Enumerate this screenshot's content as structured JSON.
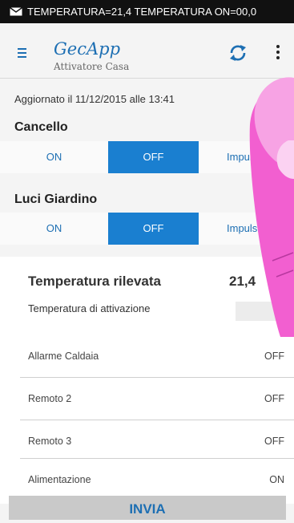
{
  "status_bar": {
    "notification_text": "TEMPERATURA=21,4 TEMPERATURA ON=00,0"
  },
  "app_bar": {
    "title": "GecApp",
    "subtitle": "Attivatore Casa"
  },
  "updated_text": "Aggiornato il 11/12/2015 alle 13:41",
  "switches": [
    {
      "name": "Cancello",
      "options": [
        "ON",
        "OFF",
        "Impuls"
      ],
      "selected": "OFF"
    },
    {
      "name": "Luci Giardino",
      "options": [
        "ON",
        "OFF",
        "Impuls"
      ],
      "selected": "OFF"
    }
  ],
  "temperature": {
    "title": "Temperatura rilevata",
    "value": "21,4",
    "activation_label": "Temperatura di attivazione",
    "activation_value": ""
  },
  "status_rows": [
    {
      "label": "Allarme Caldaia",
      "value": "OFF"
    },
    {
      "label": "Remoto 2",
      "value": "OFF"
    },
    {
      "label": "Remoto 3",
      "value": "OFF"
    },
    {
      "label": "Alimentazione",
      "value": "ON"
    }
  ],
  "send_button": "INVIA",
  "colors": {
    "accent": "#1a7fd0",
    "link": "#1d6fb3",
    "finger": "#f25fd0"
  }
}
